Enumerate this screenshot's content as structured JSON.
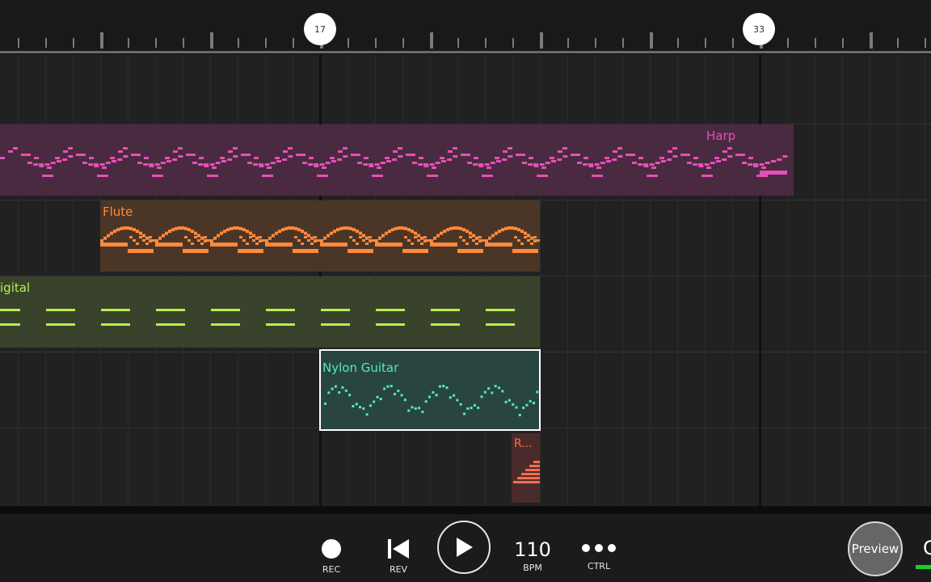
{
  "ruler": {
    "markers": [
      "17",
      "33"
    ]
  },
  "tracks": [
    {
      "name": "Harp",
      "color": "#e84fb8",
      "bg": "#4a2a40"
    },
    {
      "name": "Flute",
      "color": "#ff8a3c",
      "bg": "#4a3526"
    },
    {
      "name": "Digital",
      "visible_text": "igital",
      "color": "#b6ef4f",
      "bg": "#39422a"
    },
    {
      "name": "Nylon Guitar",
      "color": "#4ff0b0",
      "bg": "#294540",
      "selected": true
    },
    {
      "name": "R...",
      "color": "#ff6b4f",
      "bg": "#4a2b2b"
    }
  ],
  "transport": {
    "rec_label": "REC",
    "rev_label": "REV",
    "bpm_value": "110",
    "bpm_label": "BPM",
    "ctrl_label": "CTRL",
    "preview_label": "Preview",
    "edge_glyph": "C",
    "level_color": "#1ecb2c"
  }
}
